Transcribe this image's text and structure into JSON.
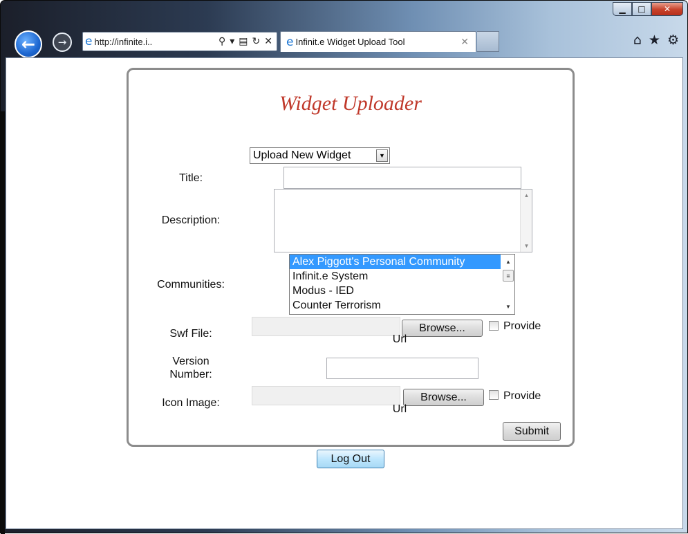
{
  "browser": {
    "address_url": "http://infinite.i..",
    "tab_title": "Infinit.e Widget Upload Tool"
  },
  "form": {
    "title": "Widget Uploader",
    "mode_select": "Upload New Widget",
    "labels": {
      "title": "Title:",
      "description": "Description:",
      "communities": "Communities:",
      "swf_file": "Swf File:",
      "version_line1": "Version",
      "version_line2": "Number:",
      "icon_image": "Icon Image:"
    },
    "title_value": "",
    "description_value": "",
    "version_value": "",
    "communities": [
      "Alex Piggott's Personal Community",
      "Infinit.e System",
      "Modus - IED",
      "Counter Terrorism"
    ],
    "browse_label": "Browse...",
    "provide_label": "Provide",
    "url_label": "Url",
    "submit_label": "Submit",
    "logout_label": "Log Out"
  }
}
